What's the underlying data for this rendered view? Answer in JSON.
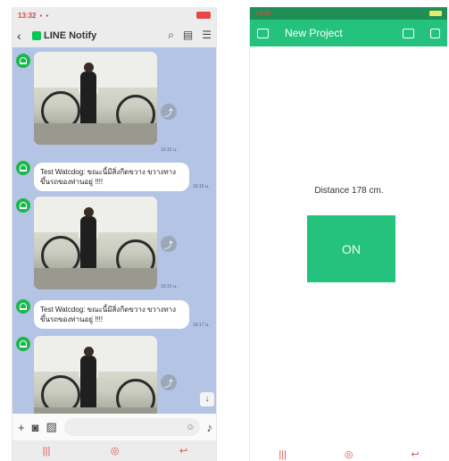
{
  "left_phone": {
    "status": {
      "time": "13:32"
    },
    "header": {
      "back_icon": "chevron-left-icon",
      "title": "LINE Notify",
      "icons": [
        "search-icon",
        "notes-icon",
        "menu-icon"
      ]
    },
    "messages": [
      {
        "type": "image",
        "time": "16:15 น."
      },
      {
        "type": "text",
        "text": "Test Watcdog: ขณะนี้มีสิ่งกีดขวาง ขวางทางขึ้นรถของท่านอยู่ !!!!",
        "time": "16:15 น."
      },
      {
        "type": "image",
        "time": "16:15 น."
      },
      {
        "type": "text",
        "text": "Test Watcdog: ขณะนี้มีสิ่งกีดขวาง ขวางทางขึ้นรถของท่านอยู่ !!!!",
        "time": "16:17 น."
      },
      {
        "type": "image",
        "time": ""
      }
    ],
    "input": {
      "icons": [
        "plus-icon",
        "camera-icon",
        "image-icon",
        "emoji-icon",
        "microphone-icon"
      ]
    },
    "nav": {
      "icons": [
        "menu-bars-icon",
        "fingerprint-icon",
        "back-arrow-icon"
      ]
    }
  },
  "right_phone": {
    "status": {
      "time": "13:56"
    },
    "header": {
      "title": "New Project"
    },
    "distance_text": "Distance  178  cm.",
    "button_label": "ON",
    "colors": {
      "accent": "#24c27d",
      "status_bar": "#1f8f55"
    }
  }
}
